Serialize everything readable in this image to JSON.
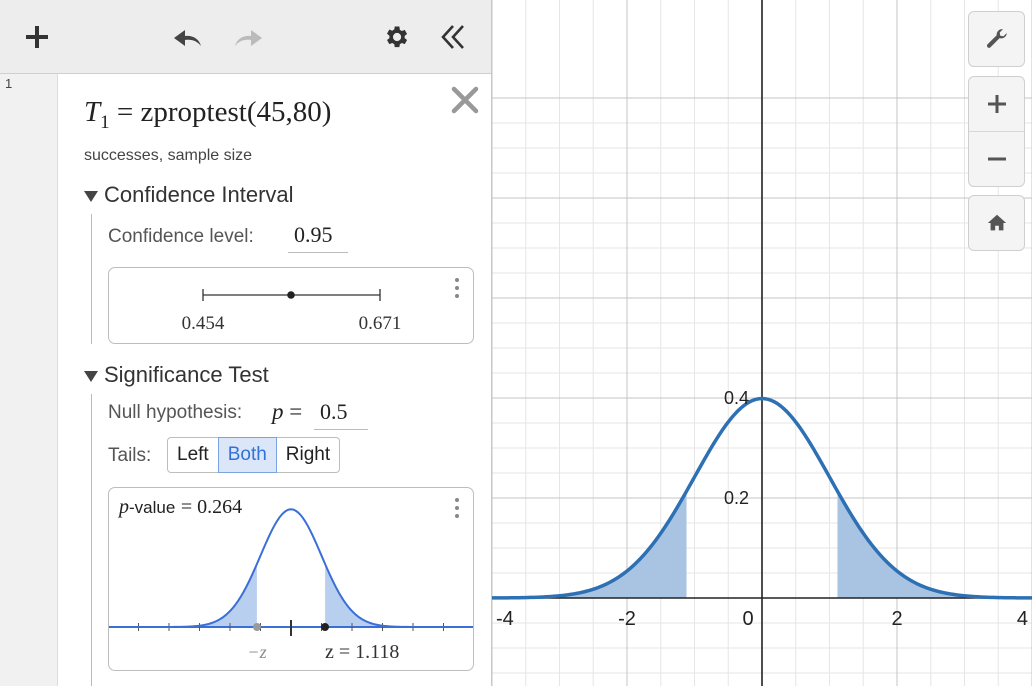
{
  "expression": {
    "row_number": "1",
    "var": "T",
    "subscript": "1",
    "equals": "=",
    "func": "zproptest",
    "args": "(45,80)",
    "hint": "successes, sample size"
  },
  "confidence_interval": {
    "header": "Confidence Interval",
    "level_label": "Confidence level:",
    "level_value": "0.95",
    "lower": "0.454",
    "upper": "0.671"
  },
  "significance_test": {
    "header": "Significance Test",
    "null_label": "Null hypothesis:",
    "null_var": "p",
    "null_eq": "=",
    "null_value": "0.5",
    "tails_label": "Tails:",
    "tails_options": [
      "Left",
      "Both",
      "Right"
    ],
    "tails_selected": "Both",
    "pvalue_var": "p",
    "pvalue_text": "-value",
    "pvalue_eq": "= 0.264",
    "neg_z_label": "−z",
    "z_label": "z = 1.118"
  },
  "graph": {
    "x_ticks": [
      "-4",
      "-2",
      "0",
      "2",
      "4"
    ],
    "y_ticks": [
      "0.2",
      "0.4"
    ],
    "curve_color": "#2d70b3",
    "shade_color": "#a9c3e2",
    "z_value": 1.118
  },
  "icons": [
    "plus-icon",
    "undo-icon",
    "redo-icon",
    "gear-icon",
    "collapse-icon",
    "close-icon",
    "wrench-icon",
    "zoom-in-icon",
    "zoom-out-icon",
    "home-icon",
    "kebab-icon"
  ]
}
